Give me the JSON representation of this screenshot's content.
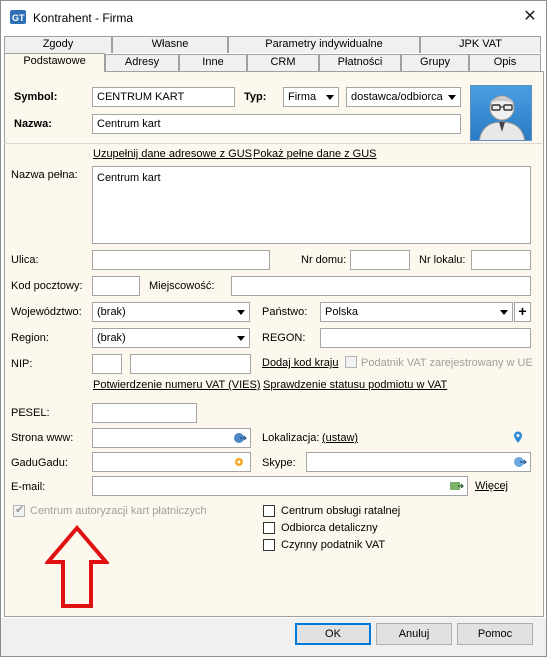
{
  "window": {
    "title": "Kontrahent - Firma",
    "close_glyph": "✕"
  },
  "tabs_row1": [
    "Zgody",
    "Własne",
    "Parametry indywidualne",
    "JPK VAT"
  ],
  "tabs_row2": [
    "Podstawowe",
    "Adresy",
    "Inne",
    "CRM",
    "Płatności",
    "Grupy",
    "Opis"
  ],
  "header": {
    "symbol_label": "Symbol:",
    "symbol_value": "CENTRUM KART",
    "typ_label": "Typ:",
    "typ_value": "Firma",
    "typ2_value": "dostawca/odbiorca",
    "nazwa_label": "Nazwa:",
    "nazwa_value": "Centrum kart"
  },
  "links": {
    "gus_fill": "Uzupełnij dane adresowe z GUS",
    "gus_show": "Pokaż pełne dane z GUS",
    "add_country_code": "Dodaj kod kraju",
    "vat_confirm": "Potwierdzenie numeru VAT (VIES)",
    "vat_status": "Sprawdzenie statusu podmiotu w VAT",
    "lokalizacja_set": "(ustaw)",
    "email_more": "Więcej"
  },
  "fields": {
    "nazwa_pelna_label": "Nazwa pełna:",
    "nazwa_pelna_value": "Centrum kart",
    "ulica_label": "Ulica:",
    "ulica_value": "",
    "nr_domu_label": "Nr domu:",
    "nr_domu_value": "",
    "nr_lokalu_label": "Nr lokalu:",
    "nr_lokalu_value": "",
    "kod_label": "Kod pocztowy:",
    "kod_value": "",
    "miejscowosc_label": "Miejscowość:",
    "miejscowosc_value": "",
    "wojewodztwo_label": "Województwo:",
    "wojewodztwo_value": "(brak)",
    "panstwo_label": "Państwo:",
    "panstwo_value": "Polska",
    "region_label": "Region:",
    "region_value": "(brak)",
    "regon_label": "REGON:",
    "regon_value": "",
    "nip_label": "NIP:",
    "nip_prefix": "",
    "nip_value": "",
    "vat_ue_label": "Podatnik VAT zarejestrowany w UE",
    "pesel_label": "PESEL:",
    "pesel_value": "",
    "www_label": "Strona www:",
    "www_value": "",
    "lokalizacja_label": "Lokalizacja:",
    "gadugadu_label": "GaduGadu:",
    "gadugadu_value": "",
    "skype_label": "Skype:",
    "skype_value": "",
    "email_label": "E-mail:",
    "email_value": ""
  },
  "checkboxes": {
    "car": {
      "label": "Centrum autoryzacji kart płatniczych",
      "checked": true,
      "disabled": true
    },
    "cor": {
      "label": "Centrum obsługi ratalnej",
      "checked": false
    },
    "od": {
      "label": "Odbiorca detaliczny",
      "checked": false
    },
    "cpv": {
      "label": "Czynny podatnik VAT",
      "checked": false
    }
  },
  "buttons": {
    "ok": "OK",
    "cancel": "Anuluj",
    "help": "Pomoc"
  },
  "colors": {
    "panel_bg": "#fdf8ee",
    "annotation_arrow": "#e01010",
    "accent_blue": "#0078d7"
  }
}
